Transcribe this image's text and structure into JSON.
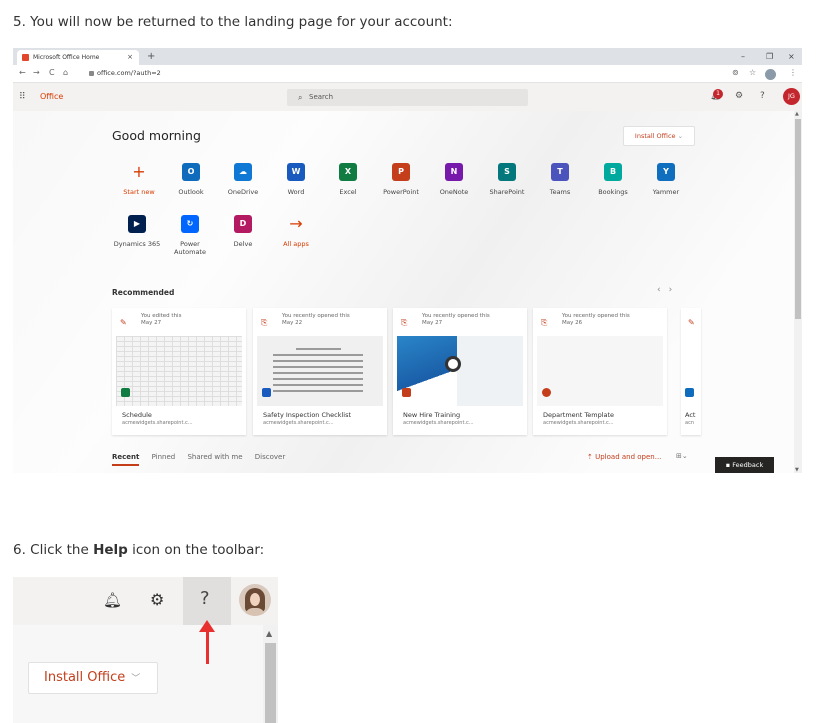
{
  "step5": {
    "text": "5. You will now be returned to the landing page for your account:"
  },
  "step6": {
    "prefix": "6. Click the ",
    "bold": "Help",
    "suffix": " icon on the toolbar:"
  },
  "browser": {
    "tab_title": "Microsoft Office Home",
    "tab_close": "×",
    "new_tab": "+",
    "window_controls": [
      "–",
      "❐",
      "×"
    ],
    "nav": [
      "←",
      "→",
      "C",
      "⌂"
    ],
    "url": "office.com/?auth=2"
  },
  "o365": {
    "waffle_icon": "waffle-icon",
    "brand": "Office",
    "search_placeholder": "Search",
    "user_initials": "JG",
    "notification_count": "1",
    "help_glyph": "?"
  },
  "home": {
    "greeting": "Good morning",
    "install_button": "Install Office",
    "apps_row1": [
      {
        "label": "Start new",
        "glyph": "+",
        "color": "#d83b01"
      },
      {
        "label": "Outlook",
        "glyph": "O",
        "color": "#0f6cbd"
      },
      {
        "label": "OneDrive",
        "glyph": "☁",
        "color": "#0f78d4"
      },
      {
        "label": "Word",
        "glyph": "W",
        "color": "#185abd"
      },
      {
        "label": "Excel",
        "glyph": "X",
        "color": "#107c41"
      },
      {
        "label": "PowerPoint",
        "glyph": "P",
        "color": "#c43e1c"
      },
      {
        "label": "OneNote",
        "glyph": "N",
        "color": "#7719aa"
      },
      {
        "label": "SharePoint",
        "glyph": "S",
        "color": "#03787c"
      },
      {
        "label": "Teams",
        "glyph": "T",
        "color": "#4b53bc"
      },
      {
        "label": "Bookings",
        "glyph": "B",
        "color": "#00a99d"
      },
      {
        "label": "Yammer",
        "glyph": "Y",
        "color": "#106ebe"
      }
    ],
    "apps_row2": [
      {
        "label": "Dynamics 365",
        "glyph": "▶",
        "color": "#002050"
      },
      {
        "label": "Power Automate",
        "glyph": "↻",
        "color": "#0066ff"
      },
      {
        "label": "Delve",
        "glyph": "D",
        "color": "#b41a61"
      },
      {
        "label": "All apps",
        "glyph": "→",
        "color": "#d83b01"
      }
    ],
    "recommended_heading": "Recommended",
    "carousel_prev": "‹",
    "carousel_next": "›",
    "cards": [
      {
        "activity": "You edited this",
        "date": "May 27",
        "name": "Schedule",
        "site": "acmewidgets.sharepoint.c...",
        "badge_color": "#107c41"
      },
      {
        "activity": "You recently opened this",
        "date": "May 22",
        "name": "Safety Inspection Checklist",
        "site": "acmewidgets.sharepoint.c...",
        "badge_color": "#185abd"
      },
      {
        "activity": "You recently opened this",
        "date": "May 27",
        "name": "New Hire Training",
        "site": "acmewidgets.sharepoint.c...",
        "badge_color": "#c43e1c"
      },
      {
        "activity": "You recently opened this",
        "date": "May 26",
        "name": "Department Template",
        "site": "acmewidgets.sharepoint.c...",
        "badge_color": "#c43e1c"
      }
    ],
    "partial_card_name": "Act",
    "partial_card_site": "acn",
    "filter_tabs": [
      "Recent",
      "Pinned",
      "Shared with me",
      "Discover"
    ],
    "upload": "Upload and open...",
    "feedback": "Feedback"
  },
  "zoom": {
    "install_button": "Install Office",
    "help_glyph": "?",
    "annotation_color": "#e8312f"
  }
}
